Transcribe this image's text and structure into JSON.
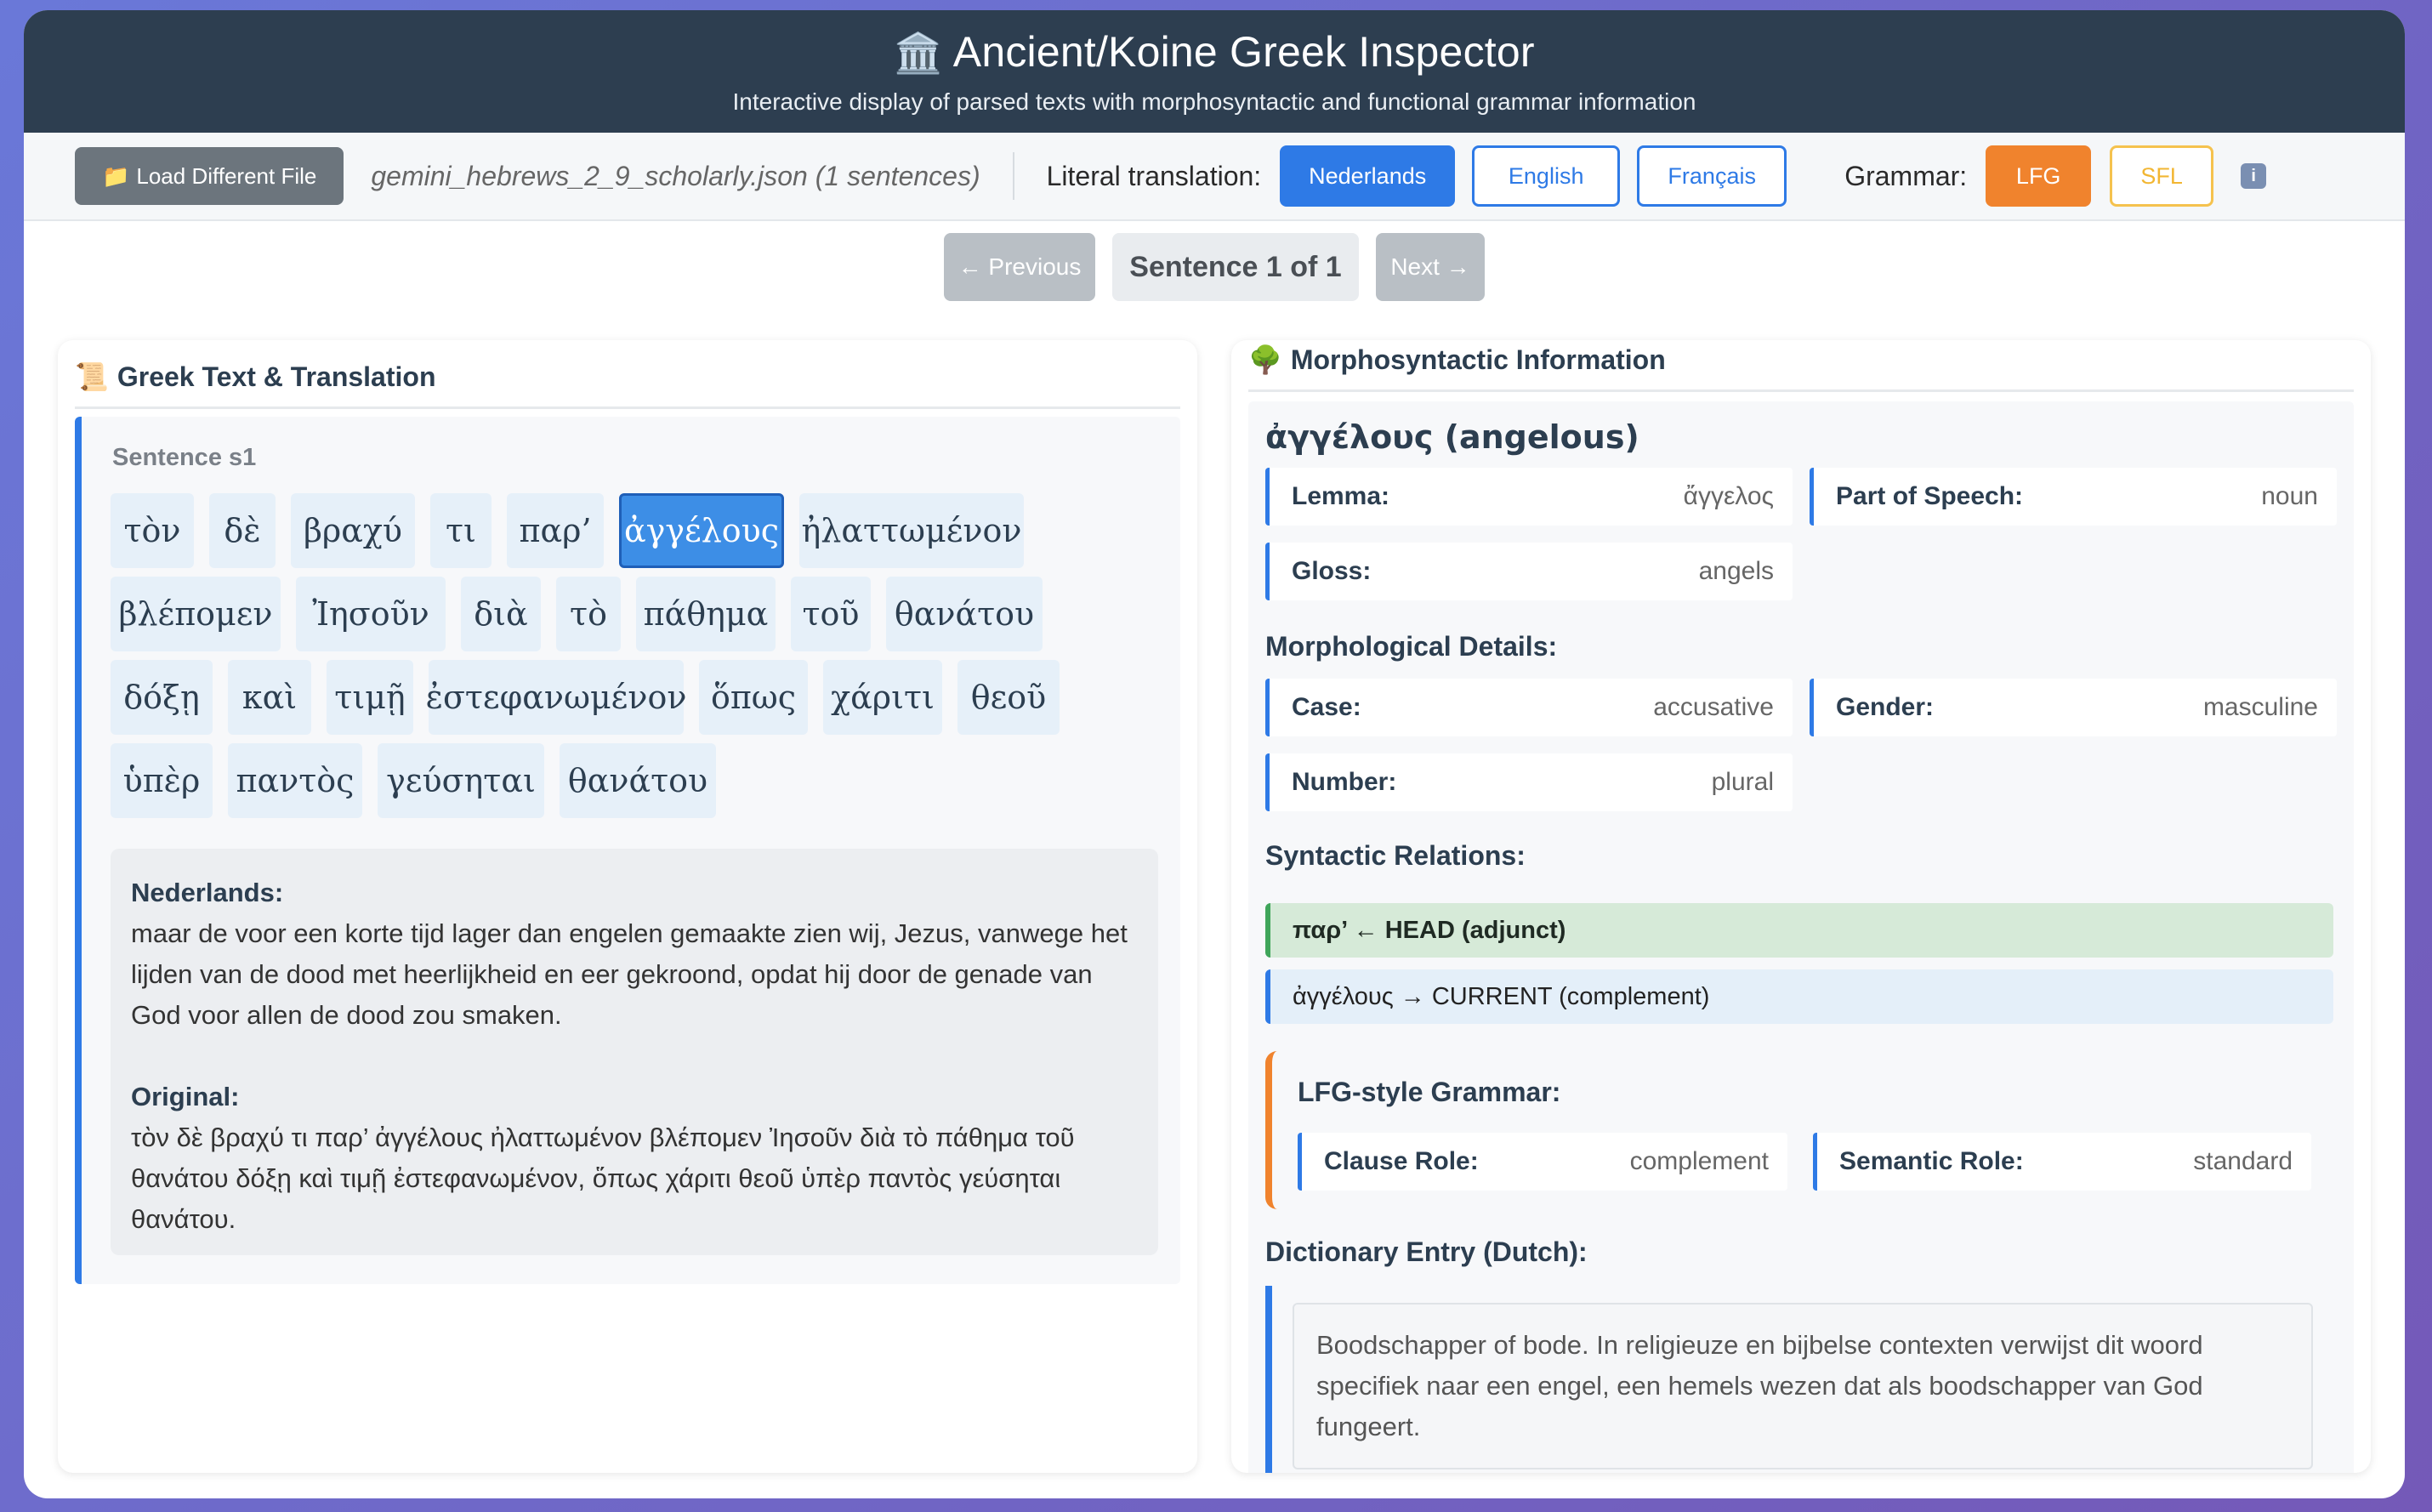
{
  "header": {
    "icon": "🏛️",
    "title": "Ancient/Koine Greek Inspector",
    "subtitle": "Interactive display of parsed texts with morphosyntactic and functional grammar information"
  },
  "toolbar": {
    "load_icon": "📁",
    "load_label": "Load Different File",
    "file_label": "gemini_hebrews_2_9_scholarly.json (1 sentences)",
    "translation_label": "Literal translation:",
    "languages": [
      "Nederlands",
      "English",
      "Français"
    ],
    "active_language": "Nederlands",
    "grammar_label": "Grammar:",
    "grammars": [
      "LFG",
      "SFL"
    ],
    "active_grammar": "LFG",
    "info_icon": "i"
  },
  "nav": {
    "prev_label": "← Previous",
    "counter": "Sentence 1 of 1",
    "next_label": "Next →"
  },
  "left_panel": {
    "icon": "📜",
    "title": "Greek Text & Translation",
    "sentence_label": "Sentence s1",
    "words": [
      "τὸν",
      "δὲ",
      "βραχύ",
      "τι",
      "παρ’",
      "ἀγγέλους",
      "ἠλαττωμένον",
      "βλέπομεν",
      "Ἰησοῦν",
      "διὰ",
      "τὸ",
      "πάθημα",
      "τοῦ",
      "θανάτου",
      "δόξῃ",
      "καὶ",
      "τιμῇ",
      "ἐστεφανωμένον",
      "ὅπως",
      "χάριτι",
      "θεοῦ",
      "ὑπὲρ",
      "παντὸς",
      "γεύσηται",
      "θανάτου"
    ],
    "selected_word_index": 5,
    "translation_heading": "Nederlands:",
    "translation_text": "maar de voor een korte tijd lager dan engelen gemaakte zien wij, Jezus, vanwege het lijden van de dood met heerlijkheid en eer gekroond, opdat hij door de genade van God voor allen de dood zou smaken.",
    "original_heading": "Original:",
    "original_text": "τὸν δὲ βραχύ τι παρ’ ἀγγέλους ἠλαττωμένον βλέπομεν Ἰησοῦν διὰ τὸ πάθημα τοῦ θανάτου δόξῃ καὶ τιμῇ ἐστεφανωμένον, ὅπως χάριτι θεοῦ ὑπὲρ παντὸς γεύσηται θανάτου."
  },
  "right_panel": {
    "icon": "🌳",
    "title": "Morphosyntactic Information",
    "word_heading": "ἀγγέλους (angelous)",
    "lemma_label": "Lemma:",
    "lemma_value": "ἄγγελος",
    "pos_label": "Part of Speech:",
    "pos_value": "noun",
    "gloss_label": "Gloss:",
    "gloss_value": "angels",
    "morph_title": "Morphological Details:",
    "case_label": "Case:",
    "case_value": "accusative",
    "gender_label": "Gender:",
    "gender_value": "masculine",
    "number_label": "Number:",
    "number_value": "plural",
    "syntax_title": "Syntactic Relations:",
    "relation_head": "παρ’ ← HEAD (adjunct)",
    "relation_current": "ἀγγέλους → CURRENT (complement)",
    "lfg_title": "LFG-style Grammar:",
    "clause_role_label": "Clause Role:",
    "clause_role_value": "complement",
    "semantic_role_label": "Semantic Role:",
    "semantic_role_value": "standard",
    "dict_title": "Dictionary Entry (Dutch):",
    "dict_text": "Boodschapper of bode. In religieuze en bijbelse contexten verwijst dit woord specifiek naar een engel, een hemels wezen dat als boodschapper van God fungeert."
  },
  "colors": {
    "header_bg": "#2d3e50",
    "accent_blue": "#2e7ae6",
    "lfg_orange": "#f0832d",
    "sfl_yellow": "#f5c24e",
    "head_green": "#3fa55a"
  }
}
